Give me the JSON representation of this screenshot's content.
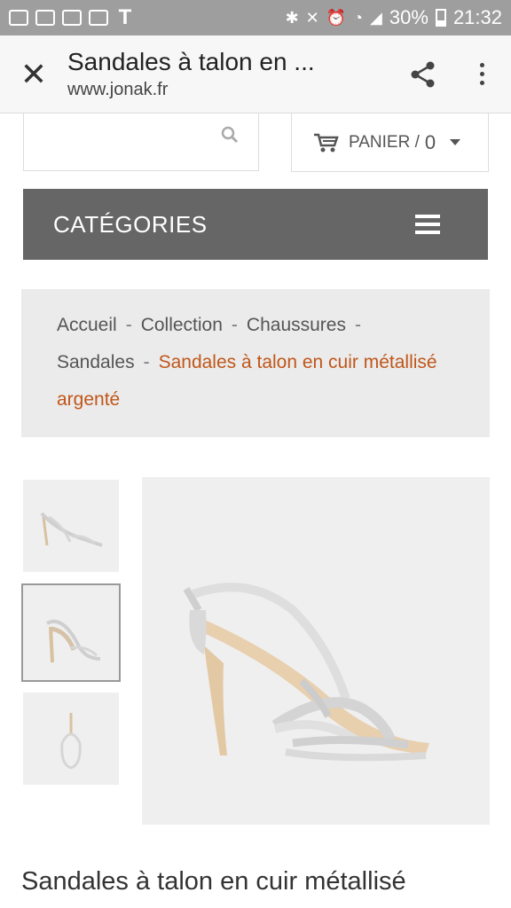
{
  "status_bar": {
    "battery": "30%",
    "time": "21:32"
  },
  "browser": {
    "page_title": "Sandales à talon en ...",
    "url": "www.jonak.fr"
  },
  "header": {
    "search_placeholder": "",
    "cart_label": "PANIER /",
    "cart_count": "0",
    "categories_label": "CATÉGORIES"
  },
  "breadcrumb": {
    "items": [
      "Accueil",
      "Collection",
      "Chaussures",
      "Sandales"
    ],
    "separator": "-",
    "current": "Sandales à talon en cuir métallisé argenté"
  },
  "product": {
    "title": "Sandales à talon en cuir métallisé"
  },
  "colors": {
    "accent": "#c0561a",
    "category_bar": "#666666",
    "status_bar": "#9e9e9e"
  }
}
